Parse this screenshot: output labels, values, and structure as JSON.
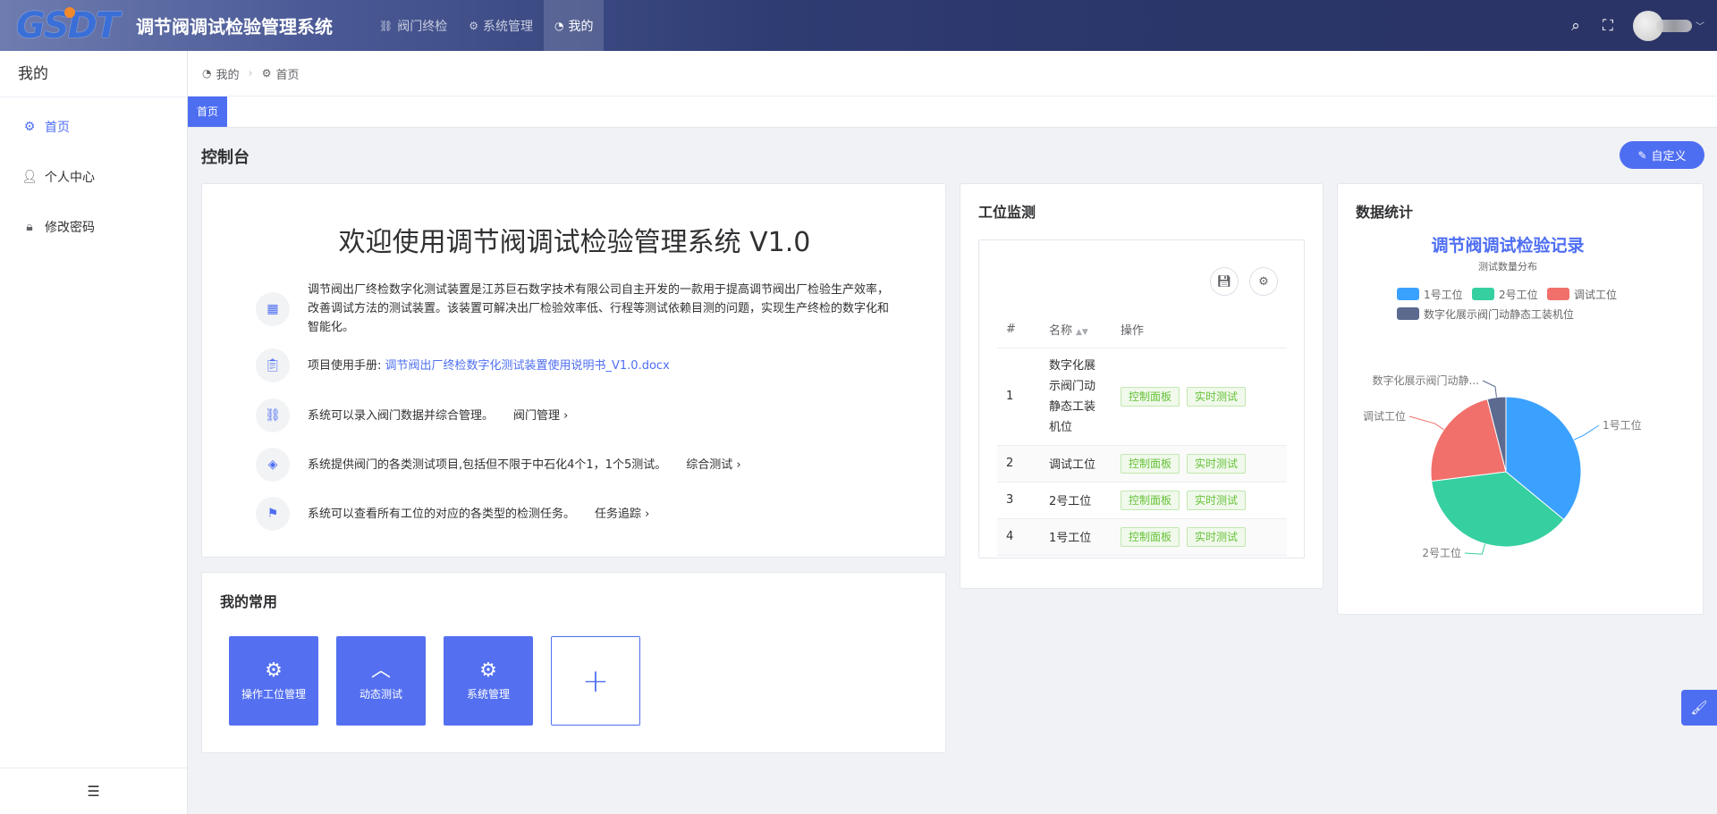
{
  "header": {
    "logo_text": "GSDT",
    "app_title": "调节阀调试检验管理系统",
    "nav": [
      {
        "label": "阀门终检",
        "icon": "link-icon"
      },
      {
        "label": "系统管理",
        "icon": "gear-icon"
      },
      {
        "label": "我的",
        "icon": "dashboard-icon",
        "active": true
      }
    ]
  },
  "sidebar": {
    "title": "我的",
    "items": [
      {
        "label": "首页",
        "icon": "gear-icon",
        "active": true
      },
      {
        "label": "个人中心",
        "icon": "user-icon"
      },
      {
        "label": "修改密码",
        "icon": "lock-icon"
      }
    ]
  },
  "breadcrumb": {
    "root": "我的",
    "current": "首页"
  },
  "tags": [
    {
      "label": "首页",
      "active": true
    }
  ],
  "page": {
    "title": "控制台",
    "customize_label": "自定义"
  },
  "welcome": {
    "title": "欢迎使用调节阀调试检验管理系统 V1.0",
    "intro": "调节阀出厂终检数字化测试装置是江苏巨石数字技术有限公司自主开发的一款用于提高调节阀出厂检验生产效率，改善调试方法的测试装置。该装置可解决出厂检验效率低、行程等测试依赖目测的问题，实现生产终检的数字化和智能化。",
    "manual_label": "项目使用手册: ",
    "manual_link": "调节阀出厂终检数字化测试装置使用说明书_V1.0.docx",
    "features": [
      {
        "text": "系统可以录入阀门数据并综合管理。",
        "nav": "阀门管理"
      },
      {
        "text": "系统提供阀门的各类测试项目,包括但不限于中石化4个1，1个5测试。",
        "nav": "综合测试"
      },
      {
        "text": "系统可以查看所有工位的对应的各类型的检测任务。",
        "nav": "任务追踪"
      }
    ]
  },
  "favorites": {
    "title": "我的常用",
    "items": [
      {
        "label": "操作工位管理",
        "icon": "gear-icon"
      },
      {
        "label": "动态测试",
        "icon": "chevron-up-icon"
      },
      {
        "label": "系统管理",
        "icon": "gear-icon"
      }
    ]
  },
  "station": {
    "title": "工位监测",
    "columns": [
      "#",
      "名称",
      "操作"
    ],
    "action_labels": [
      "控制面板",
      "实时测试"
    ],
    "rows": [
      {
        "index": "1",
        "name": "数字化展示阀门动静态工装机位"
      },
      {
        "index": "2",
        "name": "调试工位"
      },
      {
        "index": "3",
        "name": "2号工位"
      },
      {
        "index": "4",
        "name": "1号工位"
      }
    ]
  },
  "stats": {
    "title": "数据统计"
  },
  "chart_data": {
    "type": "pie",
    "title": "调节阀调试检验记录",
    "subtitle": "测试数量分布",
    "legend_position": "top",
    "categories": [
      "1号工位",
      "2号工位",
      "调试工位",
      "数字化展示阀门动静态工装机位"
    ],
    "values": [
      36,
      37,
      23,
      4
    ],
    "slice_labels": [
      "1号工位",
      "2号工位",
      "调试工位",
      "数字化展示阀门动静..."
    ],
    "colors": [
      "#3ba1ff",
      "#36cfa0",
      "#f1706b",
      "#5b6a8e"
    ]
  },
  "colors": {
    "accent": "#4e6ef2",
    "success": "#67c23a"
  }
}
